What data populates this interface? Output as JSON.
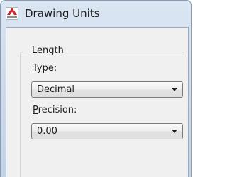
{
  "window": {
    "title": "Drawing Units",
    "icon": "autocad-icon"
  },
  "length_group": {
    "legend": "Length",
    "type": {
      "label_mnemonic": "T",
      "label_rest": "ype:",
      "selected": "Decimal"
    },
    "precision": {
      "label_mnemonic": "P",
      "label_rest": "recision:",
      "selected": "0.00"
    }
  },
  "colors": {
    "icon_red": "#d21f26",
    "frame_blue": "#cfdcec",
    "client_bg": "#f0f0f0"
  }
}
